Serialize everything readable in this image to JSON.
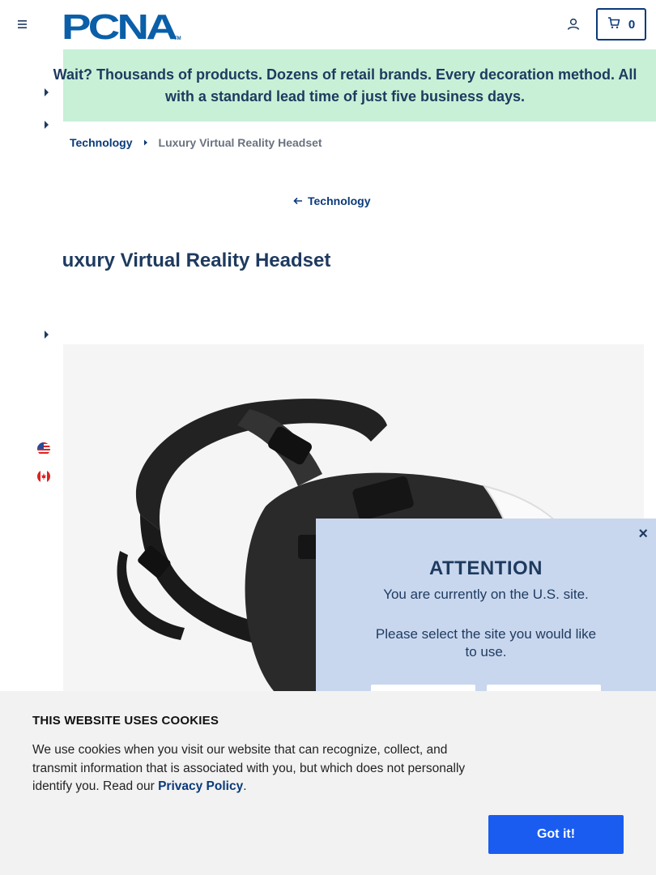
{
  "header": {
    "logo_text": "PCNA",
    "logo_tm": "TM",
    "cart_count": "0"
  },
  "promo": {
    "text": "Wait? Thousands of products. Dozens of retail brands. Every decoration method. All with a standard lead time of just five business days."
  },
  "breadcrumb": {
    "items": [
      "Technology",
      "Luxury Virtual Reality Headset"
    ]
  },
  "back_link": {
    "label": "Technology"
  },
  "product": {
    "title": "Luxury Virtual Reality Headset"
  },
  "modal": {
    "close": "×",
    "title": "ATTENTION",
    "line1": "You are currently on the U.S. site.",
    "line2": "Please select the site you would like to use."
  },
  "cookie": {
    "title": "THIS WEBSITE USES COOKIES",
    "text_before": "We use cookies when you visit our website that can recognize, collect, and transmit information that is associated with you, but which does not personally identify you. Read our ",
    "link": "Privacy Policy",
    "text_after": ".",
    "accept": "Got it!"
  },
  "colors": {
    "brand_navy": "#0a3a7a",
    "promo_bg": "#c7f0d6",
    "modal_bg": "#c8d7ee",
    "accept_blue": "#1a5cf0"
  }
}
